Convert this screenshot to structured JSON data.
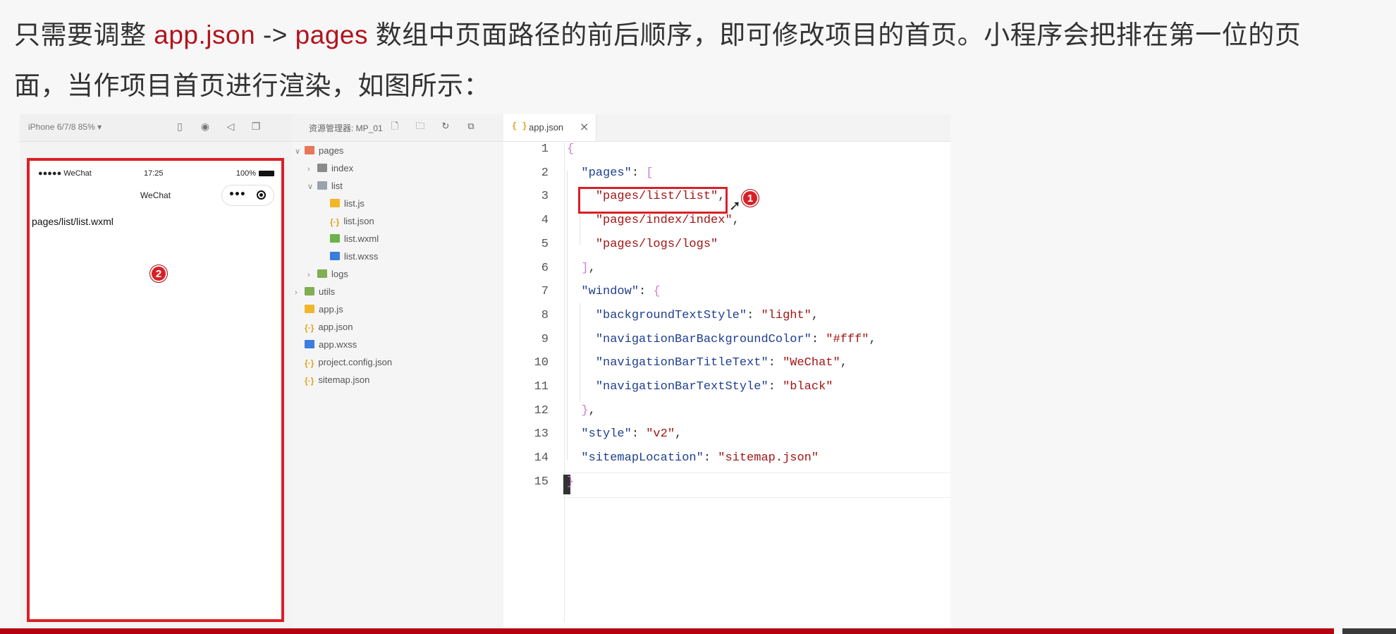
{
  "intro": {
    "seg1": "只需要调整 ",
    "kw1": "app.json",
    "seg2": " -> ",
    "kw2": "pages",
    "seg3": " 数组中页面路径的前后顺序，即可修改项目的首页。小程序会把排在第一位的页",
    "line2": "面，当作项目首页进行渲染，如图所示："
  },
  "simulator": {
    "device_label": "iPhone 6/7/8 85% ▾",
    "status": {
      "signal": "●●●●● WeChat",
      "time": "17:25",
      "battery": "100%"
    },
    "nav_title": "WeChat",
    "page_text": "pages/list/list.wxml",
    "badge": "2"
  },
  "explorer": {
    "title": "资源管理器: MP_01",
    "tree": [
      {
        "label": "pages",
        "caret": "∨",
        "icon": "folder-red",
        "depth": 0
      },
      {
        "label": "index",
        "caret": "›",
        "icon": "folder",
        "depth": 1
      },
      {
        "label": "list",
        "caret": "∨",
        "icon": "folder-open",
        "depth": 1
      },
      {
        "label": "list.js",
        "caret": "",
        "icon": "js",
        "depth": 2
      },
      {
        "label": "list.json",
        "caret": "",
        "icon": "json",
        "depth": 2
      },
      {
        "label": "list.wxml",
        "caret": "",
        "icon": "wxml",
        "depth": 2
      },
      {
        "label": "list.wxss",
        "caret": "",
        "icon": "wxss",
        "depth": 2
      },
      {
        "label": "logs",
        "caret": "›",
        "icon": "folder-green",
        "depth": 1
      },
      {
        "label": "utils",
        "caret": "›",
        "icon": "folder-green",
        "depth": 0
      },
      {
        "label": "app.js",
        "caret": "",
        "icon": "js",
        "depth": 0
      },
      {
        "label": "app.json",
        "caret": "",
        "icon": "json",
        "depth": 0
      },
      {
        "label": "app.wxss",
        "caret": "",
        "icon": "wxss",
        "depth": 0
      },
      {
        "label": "project.config.json",
        "caret": "",
        "icon": "json",
        "depth": 0
      },
      {
        "label": "sitemap.json",
        "caret": "",
        "icon": "json",
        "depth": 0
      }
    ]
  },
  "editor": {
    "tab_icon": "{ }",
    "tab_label": "app.json",
    "tab_close": "×",
    "badge": "1",
    "lines": [
      {
        "n": "1",
        "tokens": [
          [
            "brk",
            "{"
          ]
        ]
      },
      {
        "n": "2",
        "tokens": [
          [
            "pun",
            "  "
          ],
          [
            "key",
            "\"pages\""
          ],
          [
            "pun",
            ": "
          ],
          [
            "brk",
            "["
          ]
        ]
      },
      {
        "n": "3",
        "tokens": [
          [
            "pun",
            "    "
          ],
          [
            "str",
            "\"pages/list/list\""
          ],
          [
            "pun",
            ","
          ]
        ]
      },
      {
        "n": "4",
        "tokens": [
          [
            "pun",
            "    "
          ],
          [
            "str",
            "\"pages/index/index\""
          ],
          [
            "pun",
            ","
          ]
        ]
      },
      {
        "n": "5",
        "tokens": [
          [
            "pun",
            "    "
          ],
          [
            "str",
            "\"pages/logs/logs\""
          ]
        ]
      },
      {
        "n": "6",
        "tokens": [
          [
            "pun",
            "  "
          ],
          [
            "brk",
            "]"
          ],
          [
            "pun",
            ","
          ]
        ]
      },
      {
        "n": "7",
        "tokens": [
          [
            "pun",
            "  "
          ],
          [
            "key",
            "\"window\""
          ],
          [
            "pun",
            ": "
          ],
          [
            "brk",
            "{"
          ]
        ]
      },
      {
        "n": "8",
        "tokens": [
          [
            "pun",
            "    "
          ],
          [
            "key",
            "\"backgroundTextStyle\""
          ],
          [
            "pun",
            ": "
          ],
          [
            "str",
            "\"light\""
          ],
          [
            "pun",
            ","
          ]
        ]
      },
      {
        "n": "9",
        "tokens": [
          [
            "pun",
            "    "
          ],
          [
            "key",
            "\"navigationBarBackgroundColor\""
          ],
          [
            "pun",
            ": "
          ],
          [
            "str",
            "\"#fff\""
          ],
          [
            "pun",
            ","
          ]
        ]
      },
      {
        "n": "10",
        "tokens": [
          [
            "pun",
            "    "
          ],
          [
            "key",
            "\"navigationBarTitleText\""
          ],
          [
            "pun",
            ": "
          ],
          [
            "str",
            "\"WeChat\""
          ],
          [
            "pun",
            ","
          ]
        ]
      },
      {
        "n": "11",
        "tokens": [
          [
            "pun",
            "    "
          ],
          [
            "key",
            "\"navigationBarTextStyle\""
          ],
          [
            "pun",
            ": "
          ],
          [
            "str",
            "\"black\""
          ]
        ]
      },
      {
        "n": "12",
        "tokens": [
          [
            "pun",
            "  "
          ],
          [
            "brk",
            "}"
          ],
          [
            "pun",
            ","
          ]
        ]
      },
      {
        "n": "13",
        "tokens": [
          [
            "pun",
            "  "
          ],
          [
            "key",
            "\"style\""
          ],
          [
            "pun",
            ": "
          ],
          [
            "str",
            "\"v2\""
          ],
          [
            "pun",
            ","
          ]
        ]
      },
      {
        "n": "14",
        "tokens": [
          [
            "pun",
            "  "
          ],
          [
            "key",
            "\"sitemapLocation\""
          ],
          [
            "pun",
            ": "
          ],
          [
            "str",
            "\"sitemap.json\""
          ]
        ]
      },
      {
        "n": "15",
        "tokens": [
          [
            "brk",
            "}"
          ]
        ]
      }
    ]
  },
  "colors": {
    "accent": "#b3131c",
    "highlight_box": "#d92027",
    "string": "#a31515",
    "key": "#1f3f8f"
  }
}
